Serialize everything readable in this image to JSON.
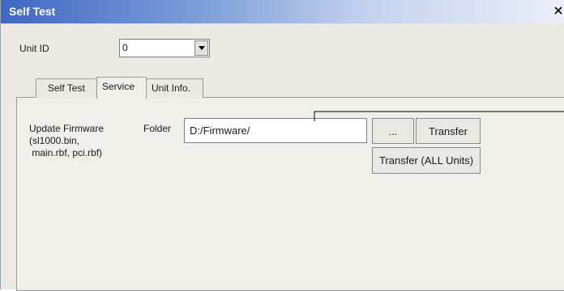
{
  "window": {
    "title": "Self Test",
    "close_glyph": "✕"
  },
  "unit_id": {
    "label": "Unit ID",
    "value": "0"
  },
  "tabs": [
    {
      "label": "Self Test"
    },
    {
      "label": "Service"
    },
    {
      "label": "Unit Info."
    }
  ],
  "active_tab": "Service",
  "service": {
    "description": "Update Firmware\n(sl1000.bin,\n main.rbf, pci.rbf)",
    "folder_label": "Folder",
    "folder_value": "D:/Firmware/",
    "browse_label": "...",
    "transfer_label": "Transfer",
    "transfer_all_label": "Transfer (ALL Units)"
  },
  "colors": {
    "title_bar_start": "#3e68c4",
    "window_bg": "#ece9e2",
    "panel_bg": "#f1efea"
  }
}
